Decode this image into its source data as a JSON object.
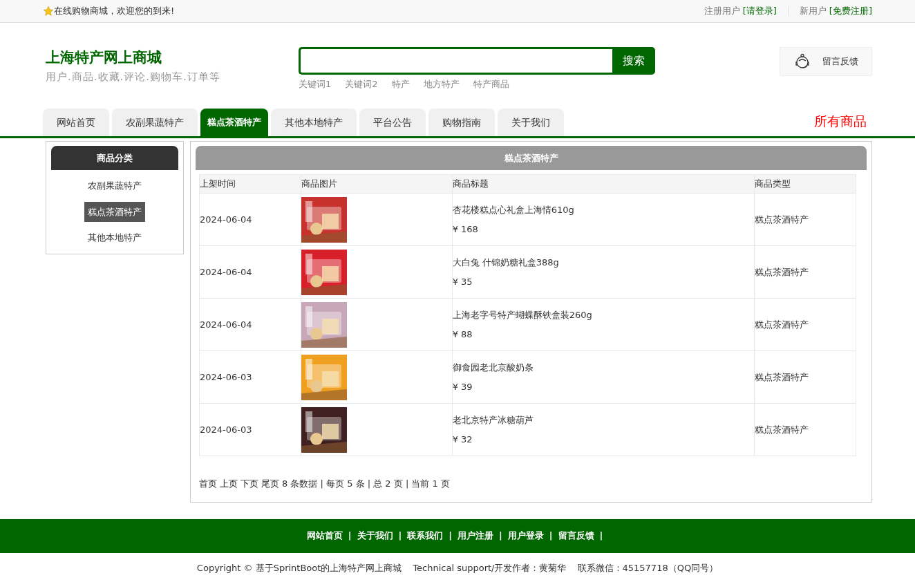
{
  "topbar": {
    "welcome": "在线购物商城，欢迎您的到来!",
    "registered_label": "注册用户",
    "login_link": "[请登录]",
    "new_label": "新用户",
    "register_link": "[免费注册]"
  },
  "header": {
    "title": "上海特产网上商城",
    "subtitle": "用户.商品.收藏.评论.购物车.订单等",
    "search": {
      "button": "搜索",
      "keywords": [
        "关键词1",
        "关键词2",
        "特产",
        "地方特产",
        "特产商品"
      ]
    },
    "feedback": "留言反馈"
  },
  "nav": {
    "tabs": [
      {
        "label": "网站首页",
        "selected": false
      },
      {
        "label": "农副果蔬特产",
        "selected": false
      },
      {
        "label": "糕点茶酒特产",
        "selected": true
      },
      {
        "label": "其他本地特产",
        "selected": false
      },
      {
        "label": "平台公告",
        "selected": false
      },
      {
        "label": "购物指南",
        "selected": false
      },
      {
        "label": "关于我们",
        "selected": false
      }
    ],
    "all_products": "所有商品"
  },
  "sidebar": {
    "title": "商品分类",
    "items": [
      {
        "label": "农副果蔬特产",
        "selected": false
      },
      {
        "label": "糕点茶酒特产",
        "selected": true
      },
      {
        "label": "其他本地特产",
        "selected": false
      }
    ]
  },
  "content": {
    "title": "糕点茶酒特产",
    "table": {
      "columns": [
        "上架时间",
        "商品图片",
        "商品标题",
        "商品类型"
      ],
      "rows": [
        {
          "date": "2024-06-04",
          "title": "杏花楼糕点心礼盒上海情610g",
          "price": "¥ 168",
          "type": "糕点茶酒特产"
        },
        {
          "date": "2024-06-04",
          "title": "大白兔 什锦奶糖礼盒388g",
          "price": "¥ 35",
          "type": "糕点茶酒特产"
        },
        {
          "date": "2024-06-04",
          "title": "上海老字号特产蝴蝶酥铁盒装260g",
          "price": "¥ 88",
          "type": "糕点茶酒特产"
        },
        {
          "date": "2024-06-03",
          "title": "御食园老北京酸奶条",
          "price": "¥ 39",
          "type": "糕点茶酒特产"
        },
        {
          "date": "2024-06-03",
          "title": "老北京特产冰糖葫芦",
          "price": "¥ 32",
          "type": "糕点茶酒特产"
        }
      ]
    },
    "pagination": {
      "links": [
        "首页",
        "上页",
        "下页",
        "尾页"
      ],
      "info": "8 条数据 | 每页 5 条 | 总 2 页 | 当前 1 页"
    }
  },
  "footer": {
    "links": [
      "网站首页",
      "关于我们",
      "联系我们",
      "用户注册",
      "用户登录",
      "留言反馈"
    ],
    "separator": "|",
    "copyright": "Copyright © 基于SprintBoot的上海特产网上商城",
    "support": "Technical support/开发作者：黄菊华",
    "contact": "联系微信：45157718（QQ同号）"
  }
}
